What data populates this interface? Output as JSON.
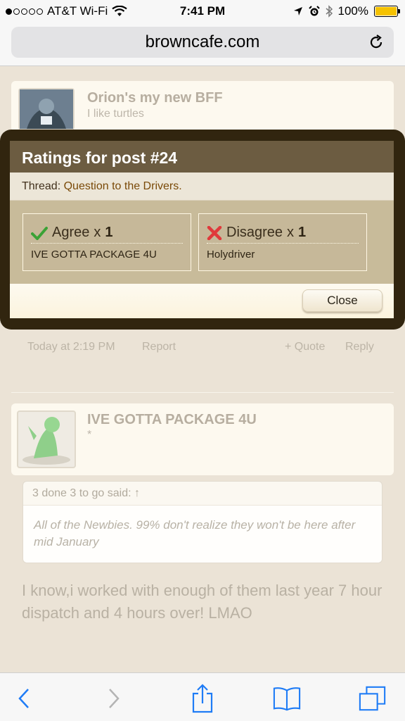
{
  "status_bar": {
    "carrier": "AT&T Wi-Fi",
    "time": "7:41 PM",
    "battery": "100%",
    "battery_level": 1.0,
    "signal_bars_filled": 1
  },
  "browser": {
    "url": "browncafe.com",
    "reload_icon": "reload-icon"
  },
  "post_top": {
    "username": "Orion's my new BFF",
    "user_title": "I like turtles",
    "timestamp": "Today at 2:19 PM",
    "report": "Report",
    "quote": "+ Quote",
    "reply": "Reply"
  },
  "post_bottom": {
    "username": "IVE GOTTA PACKAGE 4U",
    "user_title": "*",
    "quote_header": "3 done 3 to go said: ↑",
    "quote_text": "All of the Newbies. 99% don't realize they won't be here after mid January",
    "message": "I know,i worked with enough of them last year 7 hour dispatch and 4 hours over! LMAO"
  },
  "ratings_overlay": {
    "title": "Ratings for post #24",
    "thread_label": "Thread:",
    "thread_link": "Question to the Drivers.",
    "ratings": [
      {
        "label": "Agree",
        "times": "x",
        "count": "1",
        "user": "IVE GOTTA PACKAGE 4U",
        "icon": "check-icon",
        "color": "#3aa236"
      },
      {
        "label": "Disagree",
        "times": "x",
        "count": "1",
        "user": "Holydriver",
        "icon": "x-icon",
        "color": "#e0393b"
      }
    ],
    "close_label": "Close"
  },
  "colors": {
    "overlay_frame": "#31250f",
    "overlay_header": "#6c5c41",
    "thread_link": "#7a4a08",
    "ios_blue": "#1f7cf6"
  },
  "toolbar": {
    "icons": [
      "back-icon",
      "forward-icon",
      "share-icon",
      "bookmarks-icon",
      "tabs-icon"
    ]
  }
}
